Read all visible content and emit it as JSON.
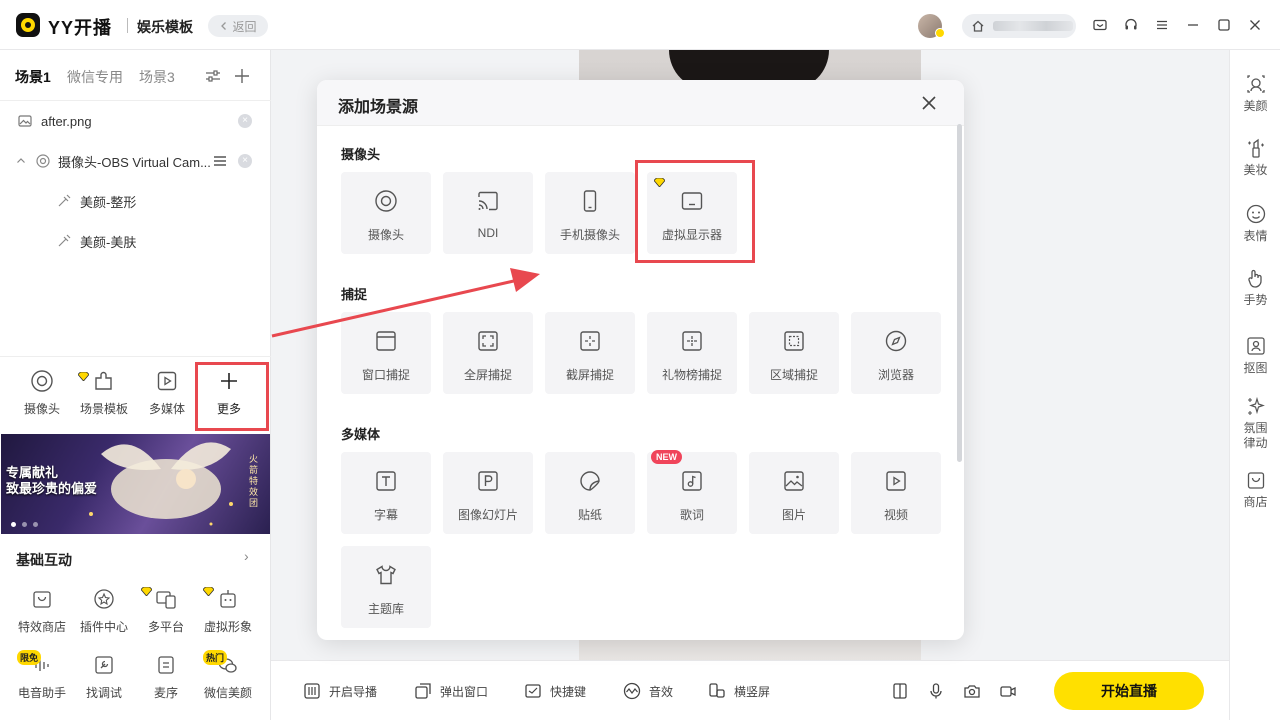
{
  "titlebar": {
    "app_name": "YY开播",
    "mode_name": "娱乐模板",
    "back_label": "返回"
  },
  "scene_tabs": [
    "场景1",
    "微信专用",
    "场景3"
  ],
  "sources": [
    {
      "label": "after.png",
      "icon": "image-icon"
    },
    {
      "label": "摄像头-OBS Virtual Cam...",
      "icon": "camera-icon"
    },
    {
      "label": "美颜-整形",
      "icon": "beauty-filter-icon"
    },
    {
      "label": "美颜-美肤",
      "icon": "beauty-filter-icon"
    }
  ],
  "quick_sources": [
    "摄像头",
    "场景模板",
    "多媒体",
    "更多"
  ],
  "banner": {
    "title_line1": "专属献礼",
    "title_line2": "致最珍贵的偏爱",
    "side_text": "火箭特效团"
  },
  "interact": {
    "title": "基础互动",
    "more": "›",
    "items": [
      "特效商店",
      "插件中心",
      "多平台",
      "虚拟形象",
      "电音助手",
      "找调试",
      "麦序",
      "微信美颜"
    ],
    "tags": {
      "free": "限免",
      "hot": "热门"
    }
  },
  "bottom_bar": {
    "items": [
      "开启导播",
      "弹出窗口",
      "快捷键",
      "音效",
      "横竖屏"
    ],
    "go_live": "开始直播"
  },
  "right_bar": [
    "美颜",
    "美妆",
    "表情",
    "手势",
    "抠图",
    "氛围律动",
    "商店"
  ],
  "dialog": {
    "title": "添加场景源",
    "sections": [
      {
        "title": "摄像头",
        "items": [
          "摄像头",
          "NDI",
          "手机摄像头",
          "虚拟显示器"
        ]
      },
      {
        "title": "捕捉",
        "items": [
          "窗口捕捉",
          "全屏捕捉",
          "截屏捕捉",
          "礼物榜捕捉",
          "区域捕捉",
          "浏览器"
        ]
      },
      {
        "title": "多媒体",
        "items": [
          "字幕",
          "图像幻灯片",
          "贴纸",
          "歌词",
          "图片",
          "视频",
          "主题库"
        ]
      }
    ],
    "new_badge": "NEW"
  },
  "colors": {
    "accent_yellow": "#ffe000",
    "highlight_red": "#e8484f",
    "new_badge": "#f0445a"
  }
}
